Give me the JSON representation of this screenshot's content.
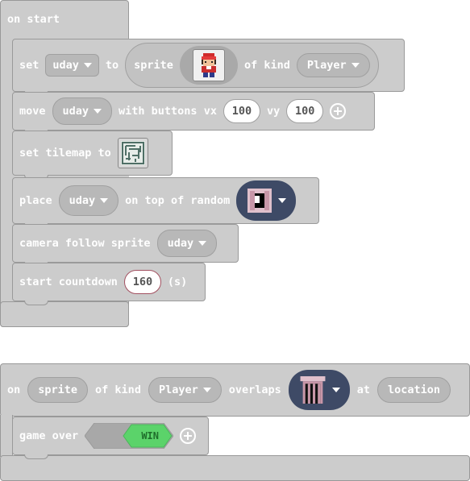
{
  "on_start": {
    "hat_label": "on start",
    "set_block": {
      "set_label": "set",
      "variable": "uday",
      "to_label": "to",
      "sprite_label": "sprite",
      "sprite_image_icon": "red-cap-character-sprite",
      "of_kind_label": "of kind",
      "kind": "Player"
    },
    "move_block": {
      "move_label": "move",
      "variable": "uday",
      "with_buttons_label": "with buttons vx",
      "vx": "100",
      "vy_label": "vy",
      "vy": "100"
    },
    "tilemap_block": {
      "label": "set tilemap to",
      "tilemap_icon": "maze-tilemap-thumbnail"
    },
    "place_block": {
      "place_label": "place",
      "variable": "uday",
      "on_top_label": "on top of random",
      "tile_icon": "door-tile-image"
    },
    "camera_block": {
      "label": "camera follow sprite",
      "variable": "uday"
    },
    "countdown_block": {
      "start_label": "start countdown",
      "seconds": "160",
      "unit_label": "(s)"
    }
  },
  "overlap_event": {
    "on_label": "on",
    "sprite_param": "sprite",
    "of_kind_label": "of kind",
    "kind": "Player",
    "overlaps_label": "overlaps",
    "tile_icon": "gate-tile-image",
    "at_label": "at",
    "location_param": "location",
    "game_over_block": {
      "label": "game over",
      "result": "WIN"
    }
  },
  "colors": {
    "block_bg": "#cccccc",
    "block_border": "#999999",
    "dark_dropdown": "#3e4a66",
    "win_green": "#5bd36a"
  }
}
